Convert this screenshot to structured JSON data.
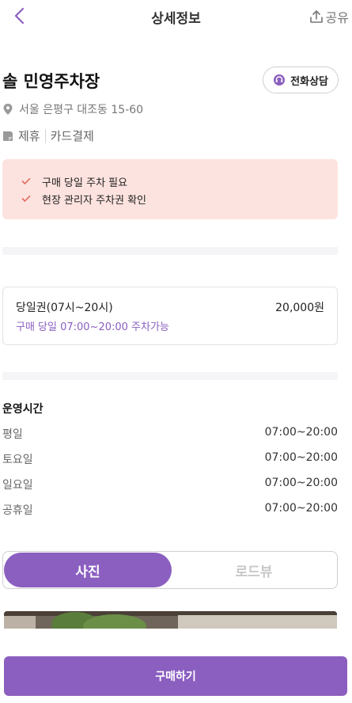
{
  "header": {
    "title": "상세정보",
    "share_label": "공유"
  },
  "place": {
    "name": "솔 민영주차장",
    "call_label": "전화상담",
    "address": "서울 은평구 대조동 15-60",
    "tags": [
      "제휴",
      "카드결제"
    ]
  },
  "notice": {
    "items": [
      "구매 당일 주차 필요",
      "현장 관리자 주차권 확인"
    ]
  },
  "ticket": {
    "name": "당일권(07시~20시)",
    "price": "20,000원",
    "description": "구매 당일 07:00~20:00 주차가능"
  },
  "hours": {
    "title": "운영시간",
    "rows": [
      {
        "day": "평일",
        "time": "07:00~20:00"
      },
      {
        "day": "토요일",
        "time": "07:00~20:00"
      },
      {
        "day": "일요일",
        "time": "07:00~20:00"
      },
      {
        "day": "공휴일",
        "time": "07:00~20:00"
      }
    ]
  },
  "tabs": {
    "photo_label": "사진",
    "roadview_label": "로드뷰"
  },
  "footer": {
    "buy_label": "구매하기"
  },
  "colors": {
    "accent": "#8b5fc0",
    "notice_bg": "#fde3df",
    "check": "#e06a5c"
  }
}
